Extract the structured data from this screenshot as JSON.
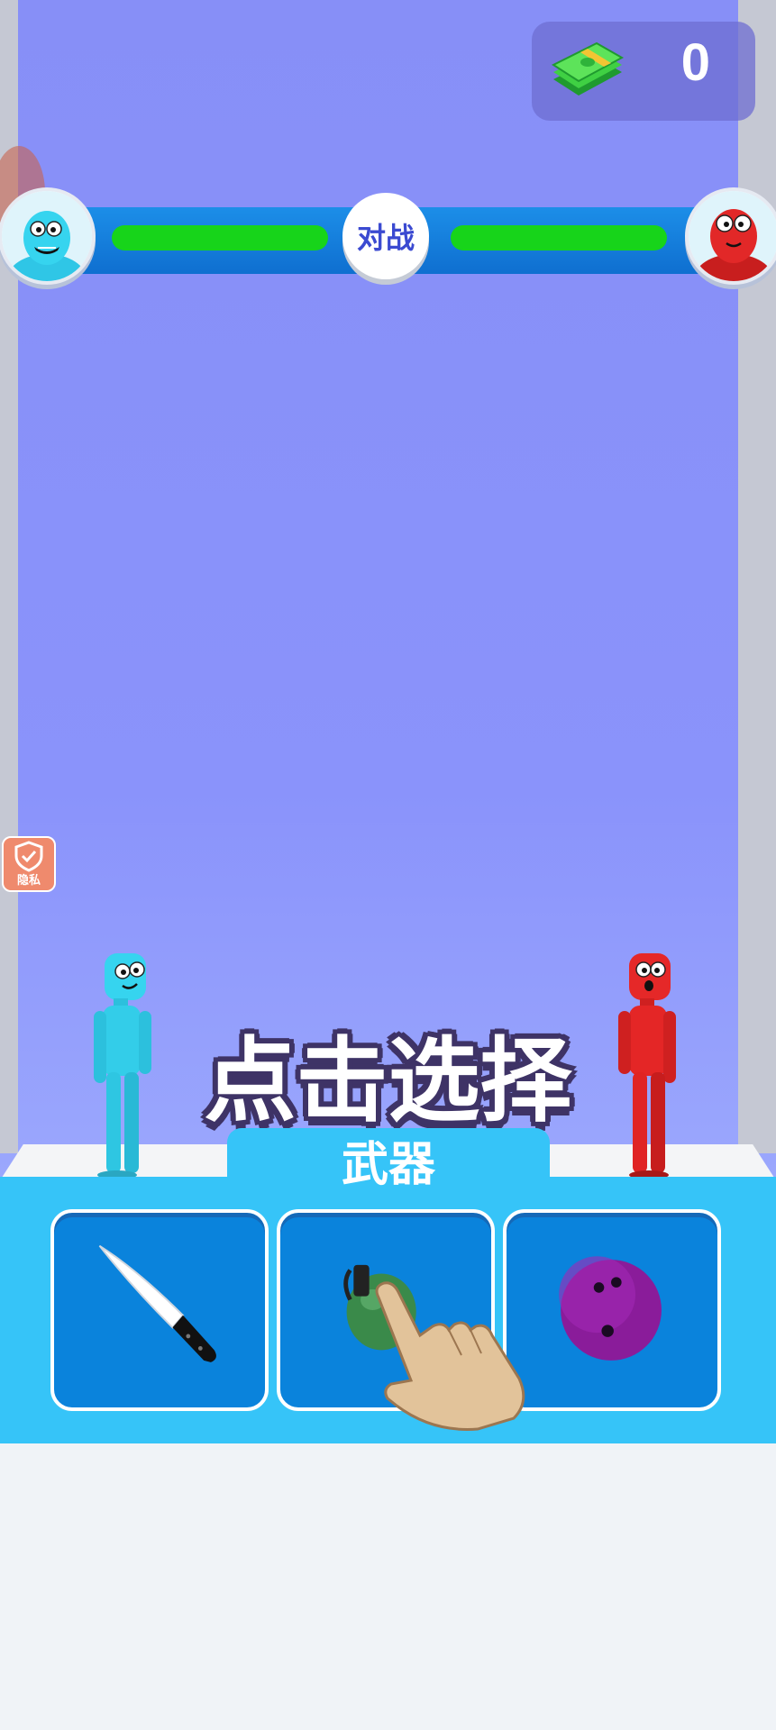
{
  "hud": {
    "money_count": "0",
    "vs_label": "对战",
    "player_health_fraction": 1.0,
    "enemy_health_fraction": 1.0
  },
  "privacy_badge": {
    "label": "隐私"
  },
  "prompt": {
    "text": "点击选择"
  },
  "weapon_panel": {
    "title": "武器",
    "slots": [
      {
        "icon": "knife-icon"
      },
      {
        "icon": "grenade-icon"
      },
      {
        "icon": "bowling-ball-icon"
      }
    ]
  },
  "colors": {
    "sky": "#878ff7",
    "health": "#17d41a",
    "panel": "#36c4f8",
    "slot": "#0a83dc",
    "player": "#2fd4ea",
    "enemy": "#e52828"
  }
}
